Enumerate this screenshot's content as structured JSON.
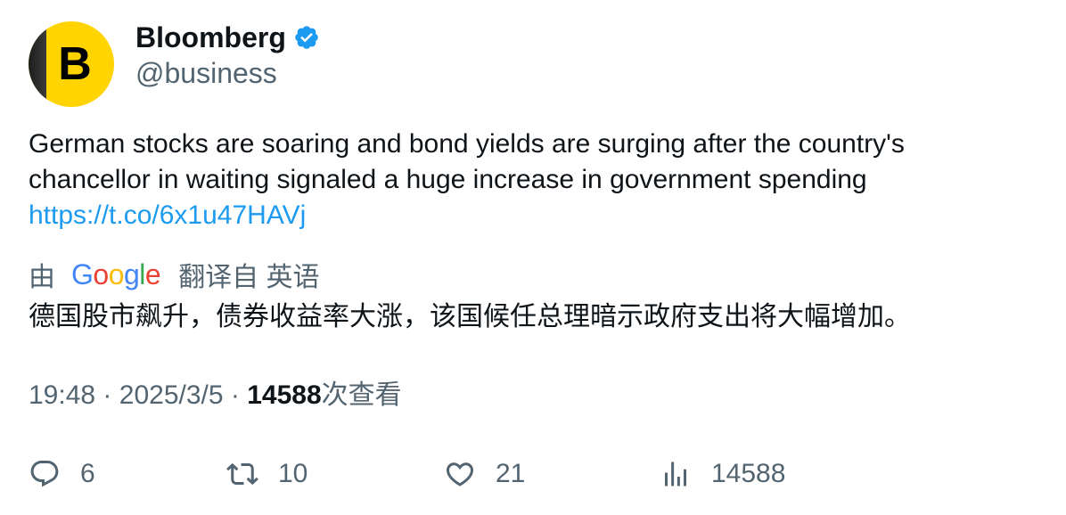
{
  "author": {
    "name": "Bloomberg",
    "handle": "@business",
    "avatar_letter": "B",
    "verified": true
  },
  "tweet": {
    "text_line1": "German stocks are soaring and bond yields are surging after the country's",
    "text_line2": "chancellor in waiting signaled a huge increase in government spending",
    "link": "https://t.co/6x1u47HAVj"
  },
  "translation": {
    "prefix": "由",
    "provider_letters": [
      "G",
      "o",
      "o",
      "g",
      "l",
      "e"
    ],
    "provider_colors": [
      "#4285f4",
      "#ea4335",
      "#fbbc05",
      "#4285f4",
      "#34a853",
      "#ea4335"
    ],
    "suffix": "翻译自 英语",
    "text": "德国股市飙升，债券收益率大涨，该国候任总理暗示政府支出将大幅增加。"
  },
  "meta": {
    "time": "19:48",
    "date": "2025/3/5",
    "separator": "·",
    "views_count": "14588",
    "views_label": "次查看"
  },
  "actions": {
    "replies": "6",
    "retweets": "10",
    "likes": "21",
    "views": "14588"
  },
  "colors": {
    "verified_badge": "#1d9bf0",
    "link": "#1d9bf0",
    "muted": "#536471",
    "avatar_bg": "#ffd400"
  },
  "icons": [
    "verified-badge-icon",
    "reply-icon",
    "retweet-icon",
    "like-icon",
    "views-icon"
  ]
}
